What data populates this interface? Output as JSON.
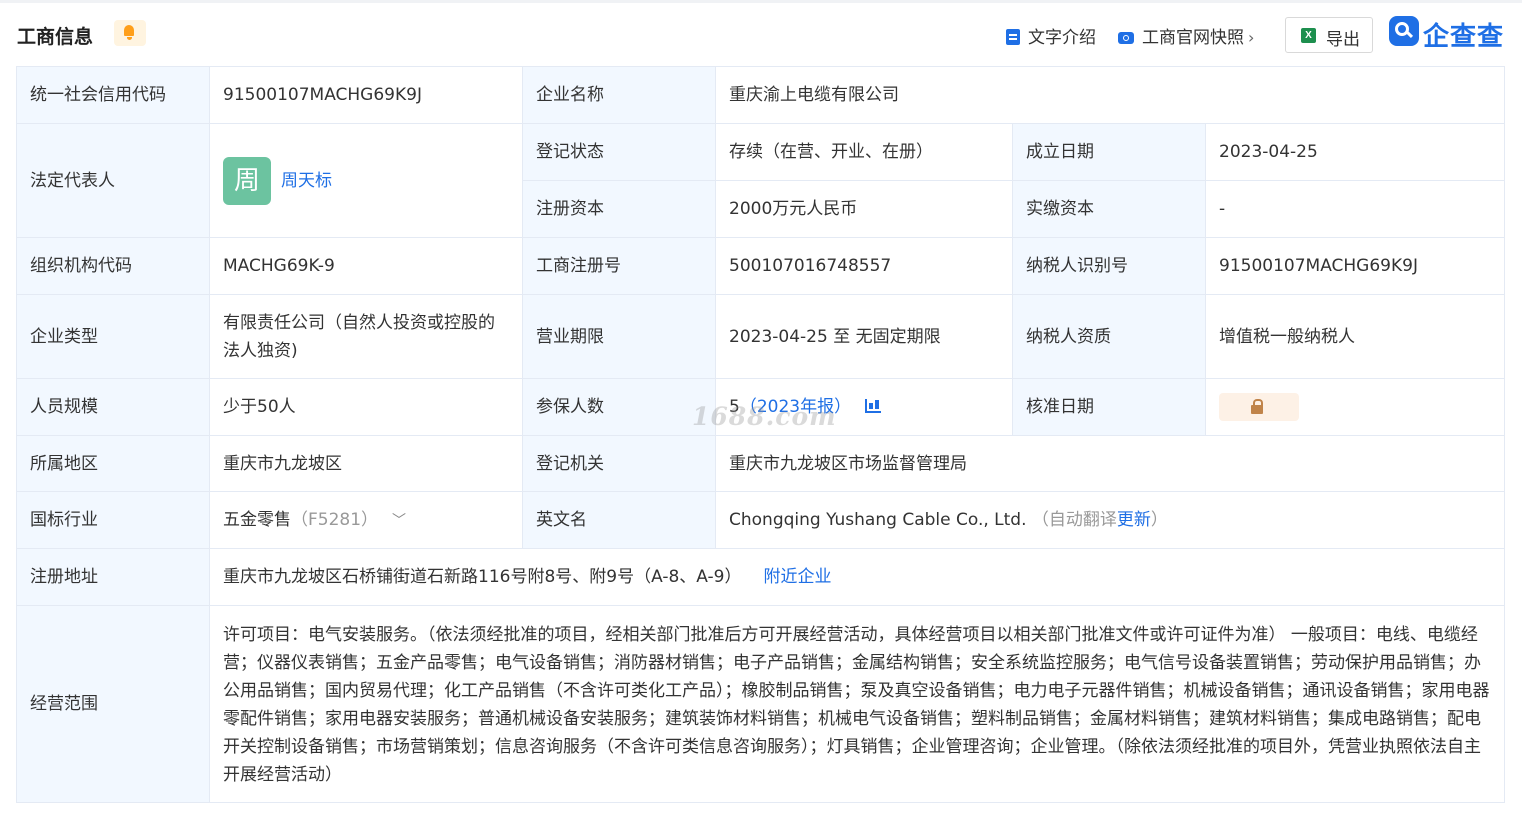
{
  "header": {
    "title": "工商信息",
    "text_intro": "文字介绍",
    "official_snapshot": "工商官网快照",
    "export": "导出",
    "brand": "企查查",
    "excel_icon_letter": "X"
  },
  "rows": {
    "credit_code": {
      "label": "统一社会信用代码",
      "value": "91500107MACHG69K9J"
    },
    "company_name": {
      "label": "企业名称",
      "value": "重庆渝上电缆有限公司"
    },
    "legal_rep": {
      "label": "法定代表人",
      "avatar_char": "周",
      "name": "周天标"
    },
    "reg_status": {
      "label": "登记状态",
      "value": "存续（在营、开业、在册）"
    },
    "founded": {
      "label": "成立日期",
      "value": "2023-04-25"
    },
    "reg_capital": {
      "label": "注册资本",
      "value": "2000万元人民币"
    },
    "paid_capital": {
      "label": "实缴资本",
      "value": "-"
    },
    "org_code": {
      "label": "组织机构代码",
      "value": "MACHG69K-9"
    },
    "biz_reg_no": {
      "label": "工商注册号",
      "value": "500107016748557"
    },
    "taxpayer_id": {
      "label": "纳税人识别号",
      "value": "91500107MACHG69K9J"
    },
    "company_type": {
      "label": "企业类型",
      "value": "有限责任公司（自然人投资或控股的法人独资)"
    },
    "biz_term": {
      "label": "营业期限",
      "value": "2023-04-25 至 无固定期限"
    },
    "taxpayer_qual": {
      "label": "纳税人资质",
      "value": "增值税一般纳税人"
    },
    "staff_size": {
      "label": "人员规模",
      "value": "少于50人"
    },
    "insured": {
      "label": "参保人数",
      "value": "5",
      "report": "（2023年报）"
    },
    "approval_date": {
      "label": "核准日期"
    },
    "region": {
      "label": "所属地区",
      "value": "重庆市九龙坡区"
    },
    "reg_authority": {
      "label": "登记机关",
      "value": "重庆市九龙坡区市场监督管理局"
    },
    "industry": {
      "label": "国标行业",
      "value": "五金零售",
      "code": "（F5281）"
    },
    "english_name": {
      "label": "英文名",
      "value": "Chongqing Yushang Cable Co., Ltd.",
      "auto_prefix": "（自动翻译",
      "update": "更新",
      "auto_suffix": "）"
    },
    "address": {
      "label": "注册地址",
      "value": "重庆市九龙坡区石桥铺街道石新路116号附8号、附9号（A-8、A-9）",
      "nearby": "附近企业"
    },
    "scope": {
      "label": "经营范围",
      "value": "许可项目：电气安装服务。（依法须经批准的项目，经相关部门批准后方可开展经营活动，具体经营项目以相关部门批准文件或许可证件为准） 一般项目：电线、电缆经营；仪器仪表销售；五金产品零售；电气设备销售；消防器材销售；电子产品销售；金属结构销售；安全系统监控服务；电气信号设备装置销售；劳动保护用品销售；办公用品销售；国内贸易代理；化工产品销售（不含许可类化工产品）；橡胶制品销售；泵及真空设备销售；电力电子元器件销售；机械设备销售；通讯设备销售；家用电器零配件销售；家用电器安装服务；普通机械设备安装服务；建筑装饰材料销售；机械电气设备销售；塑料制品销售；金属材料销售；建筑材料销售；集成电路销售；配电开关控制设备销售；市场营销策划；信息咨询服务（不含许可类信息咨询服务）；灯具销售；企业管理咨询；企业管理。（除依法须经批准的项目外，凭营业执照依法自主开展经营活动）"
    }
  },
  "watermark": "1688.com",
  "colors": {
    "accent": "#1f6fe5",
    "label_bg": "#f2f8ff",
    "border": "#e4eaf4",
    "avatar": "#6cc3a0"
  }
}
